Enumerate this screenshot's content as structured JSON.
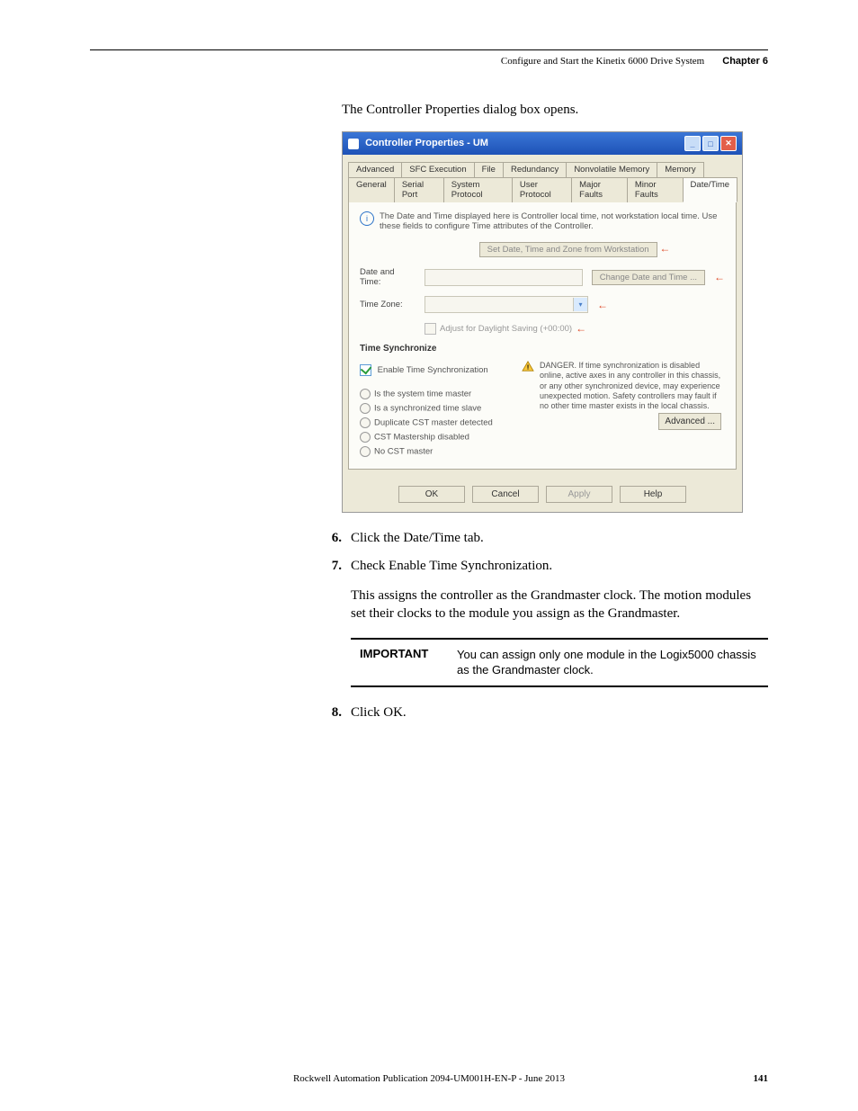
{
  "header": {
    "doc_title": "Configure and Start the Kinetix 6000 Drive System",
    "chapter_label": "Chapter 6"
  },
  "intro": "The Controller Properties dialog box opens.",
  "dialog": {
    "title": "Controller Properties - UM",
    "tabs_row1": [
      "Advanced",
      "SFC Execution",
      "File",
      "Redundancy",
      "Nonvolatile Memory",
      "Memory"
    ],
    "tabs_row2": [
      "General",
      "Serial Port",
      "System Protocol",
      "User Protocol",
      "Major Faults",
      "Minor Faults",
      "Date/Time"
    ],
    "info_text": "The Date and Time displayed here is Controller local time, not workstation local time. Use these fields to configure Time attributes of the Controller.",
    "btn_set": "Set Date, Time and Zone from Workstation",
    "label_datetime": "Date and Time:",
    "btn_change": "Change Date and Time ...",
    "label_timezone": "Time Zone:",
    "adjust_dst": "Adjust for Daylight Saving (+00:00)",
    "section_sync": "Time Synchronize",
    "chk_enable": "Enable Time Synchronization",
    "radio1": "Is the system time master",
    "radio2": "Is a synchronized time slave",
    "radio3": "Duplicate CST master detected",
    "radio4": "CST Mastership disabled",
    "radio5": "No CST master",
    "warn_text": "DANGER. If time synchronization is disabled online, active axes in any controller in this chassis, or any other synchronized device, may experience unexpected motion. Safety controllers may fault if no other time master exists in the local chassis.",
    "btn_ok": "OK",
    "btn_cancel": "Cancel",
    "btn_apply": "Apply",
    "btn_help": "Help",
    "btn_advanced": "Advanced ..."
  },
  "steps": {
    "s6": "Click the Date/Time tab.",
    "s7": "Check Enable Time Synchronization.",
    "s7_sub": "This assigns the controller as the Grandmaster clock. The motion modules set their clocks to the module you assign as the Grandmaster.",
    "s8": "Click OK."
  },
  "important": {
    "label": "IMPORTANT",
    "text": "You can assign only one module in the Logix5000 chassis as the Grandmaster clock."
  },
  "footer": {
    "pub": "Rockwell Automation Publication 2094-UM001H-EN-P - June 2013",
    "page": "141"
  }
}
